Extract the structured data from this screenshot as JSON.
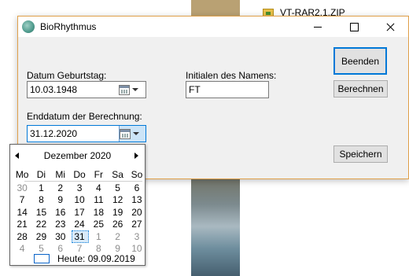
{
  "background": {
    "file_label": "VT-RAR2.1.ZIP"
  },
  "window": {
    "title": "BioRhythmus"
  },
  "form": {
    "birth_label": "Datum Geburtstag:",
    "birth_value": "10.03.1948",
    "initials_label": "Initialen des Namens:",
    "initials_value": "FT",
    "end_label": "Enddatum der Berechnung:",
    "end_value": "31.12.2020"
  },
  "buttons": {
    "quit": "Beenden",
    "calculate": "Berechnen",
    "save": "Speichern"
  },
  "calendar": {
    "month_title": "Dezember 2020",
    "weekdays": [
      "Mo",
      "Di",
      "Mi",
      "Do",
      "Fr",
      "Sa",
      "So"
    ],
    "weeks": [
      [
        {
          "d": "30",
          "o": true
        },
        {
          "d": "1"
        },
        {
          "d": "2"
        },
        {
          "d": "3"
        },
        {
          "d": "4"
        },
        {
          "d": "5"
        },
        {
          "d": "6"
        }
      ],
      [
        {
          "d": "7"
        },
        {
          "d": "8"
        },
        {
          "d": "9"
        },
        {
          "d": "10"
        },
        {
          "d": "11"
        },
        {
          "d": "12"
        },
        {
          "d": "13"
        }
      ],
      [
        {
          "d": "14"
        },
        {
          "d": "15"
        },
        {
          "d": "16"
        },
        {
          "d": "17"
        },
        {
          "d": "18"
        },
        {
          "d": "19"
        },
        {
          "d": "20"
        }
      ],
      [
        {
          "d": "21"
        },
        {
          "d": "22"
        },
        {
          "d": "23"
        },
        {
          "d": "24"
        },
        {
          "d": "25"
        },
        {
          "d": "26"
        },
        {
          "d": "27"
        }
      ],
      [
        {
          "d": "28"
        },
        {
          "d": "29"
        },
        {
          "d": "30"
        },
        {
          "d": "31",
          "s": true
        },
        {
          "d": "1",
          "o": true
        },
        {
          "d": "2",
          "o": true
        },
        {
          "d": "3",
          "o": true
        }
      ],
      [
        {
          "d": "4",
          "o": true
        },
        {
          "d": "5",
          "o": true
        },
        {
          "d": "6",
          "o": true
        },
        {
          "d": "7",
          "o": true
        },
        {
          "d": "8",
          "o": true
        },
        {
          "d": "9",
          "o": true
        },
        {
          "d": "10",
          "o": true
        }
      ]
    ],
    "today_text": "Heute: 09.09.2019"
  }
}
